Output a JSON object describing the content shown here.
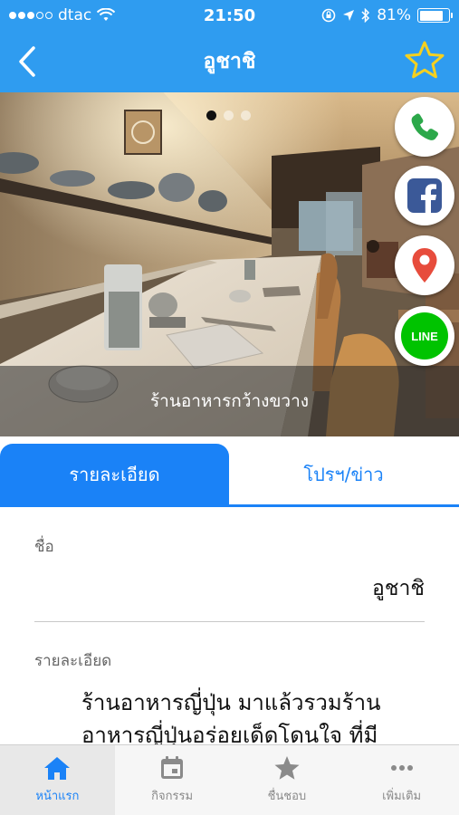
{
  "status_bar": {
    "carrier": "dtac",
    "time": "21:50",
    "battery_percent": "81%",
    "battery_level": 0.81
  },
  "nav": {
    "title": "อูชาชิ"
  },
  "hero": {
    "caption": "ร้านอาหารกว้างขวาง",
    "slide_count": 3,
    "active_slide": 1
  },
  "social": {
    "phone_icon": "phone-icon",
    "facebook_icon": "facebook-icon",
    "map_icon": "map-pin-icon",
    "line_icon": "line-icon",
    "line_label": "LINE"
  },
  "tabs": {
    "details": "รายละเอียด",
    "promo": "โปรฯ/ข่าว"
  },
  "details": {
    "name_label": "ชื่อ",
    "name_value": "อูชาชิ",
    "desc_label": "รายละเอียด",
    "desc_line1": "ร้านอาหารญี่ปุ่น มาแล้วรวมร้าน",
    "desc_line2": "อาหารญี่ปุ่นอร่อยเด็ดโดนใจ ที่มี"
  },
  "bottom_tabs": {
    "home": "หน้าแรก",
    "activity": "กิจกรรม",
    "favorites": "ชื่นชอบ",
    "more": "เพิ่มเติม"
  },
  "colors": {
    "brand_blue": "#2f9cf0",
    "accent_blue": "#1a82f7",
    "star_yellow": "#f5d020",
    "facebook": "#3b5998",
    "map_red": "#e74c3c",
    "line_green": "#00c300"
  }
}
